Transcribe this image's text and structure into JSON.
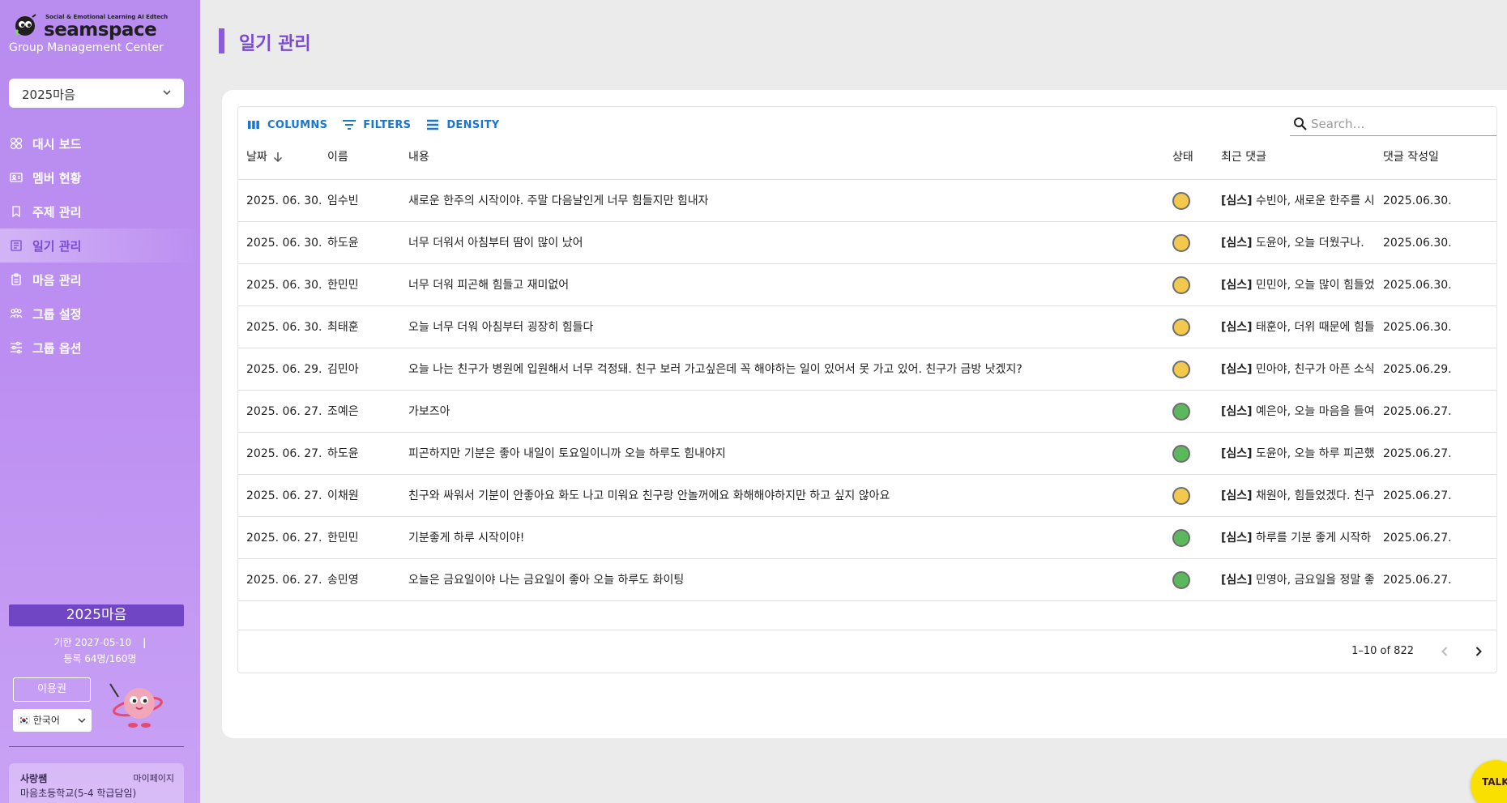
{
  "brand": {
    "tagline": "Social & Emotional Learning AI Edtech",
    "name": "seamspace",
    "subtitle": "Group Management Center"
  },
  "group_select": {
    "value": "2025마음"
  },
  "nav": [
    {
      "label": "대시 보드",
      "icon": "dashboard-icon",
      "active": false
    },
    {
      "label": "멤버 현황",
      "icon": "member-card-icon",
      "active": false
    },
    {
      "label": "주제 관리",
      "icon": "bookmark-icon",
      "active": false
    },
    {
      "label": "일기 관리",
      "icon": "diary-icon",
      "active": true
    },
    {
      "label": "마음 관리",
      "icon": "clipboard-icon",
      "active": false
    },
    {
      "label": "그룹 설정",
      "icon": "group-icon",
      "active": false
    },
    {
      "label": "그룹 옵션",
      "icon": "sliders-icon",
      "active": false
    }
  ],
  "plan": {
    "name": "2025마음",
    "expiry": "기한 2027-05-10",
    "separator": "|",
    "registered": "등록 64명/160명",
    "license_button": "이용권",
    "language": "🇰🇷 한국어"
  },
  "user": {
    "name": "사랑쌤",
    "mypage": "마이페이지",
    "school": "마음초등학교(5-4 학급담임)"
  },
  "page": {
    "title": "일기 관리"
  },
  "toolbar": {
    "columns": "COLUMNS",
    "filters": "FILTERS",
    "density": "DENSITY",
    "search_placeholder": "Search…"
  },
  "table": {
    "headers": {
      "date": "날짜",
      "name": "이름",
      "content": "내용",
      "status": "상태",
      "comment": "최근 댓글",
      "comment_date": "댓글 작성일"
    },
    "rows": [
      {
        "date": "2025. 06. 30.",
        "name": "임수빈",
        "content": "새로운 한주의 시작이야. 주말 다음날인게 너무 힘들지만 힘내자",
        "status": "yellow",
        "comment_tag": "[심스]",
        "comment": " 수빈아, 새로운 한주를 시",
        "comment_date": "2025.06.30."
      },
      {
        "date": "2025. 06. 30.",
        "name": "하도윤",
        "content": "너무 더워서 아침부터 땀이 많이 났어",
        "status": "yellow",
        "comment_tag": "[심스]",
        "comment": " 도윤아, 오늘 더웠구나.",
        "comment_date": "2025.06.30."
      },
      {
        "date": "2025. 06. 30.",
        "name": "한민민",
        "content": "너무 더워 피곤해 힘들고 재미없어",
        "status": "yellow",
        "comment_tag": "[심스]",
        "comment": " 민민아, 오늘 많이 힘들었",
        "comment_date": "2025.06.30."
      },
      {
        "date": "2025. 06. 30.",
        "name": "최태훈",
        "content": "오늘 너무 더워 아침부터 굉장히 힘들다",
        "status": "yellow",
        "comment_tag": "[심스]",
        "comment": " 태훈아, 더위 때문에 힘들",
        "comment_date": "2025.06.30."
      },
      {
        "date": "2025. 06. 29.",
        "name": "김민아",
        "content": "오늘 나는 친구가 병원에 입원해서 너무 걱정돼. 친구 보러 가고싶은데 꼭 해야하는 일이 있어서 못 가고 있어. 친구가 금방 낫겠지?",
        "status": "yellow",
        "comment_tag": "[심스]",
        "comment": " 민아야, 친구가 아픈 소식",
        "comment_date": "2025.06.29."
      },
      {
        "date": "2025. 06. 27.",
        "name": "조예은",
        "content": "가보즈아",
        "status": "green",
        "comment_tag": "[심스]",
        "comment": " 예은아, 오늘 마음을 들여",
        "comment_date": "2025.06.27."
      },
      {
        "date": "2025. 06. 27.",
        "name": "하도윤",
        "content": "피곤하지만 기분은 좋아 내일이 토요일이니까 오늘 하루도 힘내야지",
        "status": "green",
        "comment_tag": "[심스]",
        "comment": " 도윤아, 오늘 하루 피곤했",
        "comment_date": "2025.06.27."
      },
      {
        "date": "2025. 06. 27.",
        "name": "이채원",
        "content": "친구와 싸워서 기분이 안좋아요 화도 나고 미워요 친구랑 안놀꺼에요 화해해야하지만 하고 싶지 않아요",
        "status": "yellow",
        "comment_tag": "[심스]",
        "comment": " 채원아, 힘들었겠다. 친구",
        "comment_date": "2025.06.27."
      },
      {
        "date": "2025. 06. 27.",
        "name": "한민민",
        "content": "기분좋게 하루 시작이야!",
        "status": "green",
        "comment_tag": "[심스]",
        "comment": " 하루를 기분 좋게 시작하",
        "comment_date": "2025.06.27."
      },
      {
        "date": "2025. 06. 27.",
        "name": "송민영",
        "content": "오늘은 금요일이야 나는 금요일이 좋아 오늘 하루도 화이팅",
        "status": "green",
        "comment_tag": "[심스]",
        "comment": " 민영아, 금요일을 정말 좋",
        "comment_date": "2025.06.27."
      }
    ],
    "status_colors": {
      "yellow": "#f2c94c",
      "green": "#5cb85c"
    },
    "pagination": "1–10 of 822"
  },
  "talk_button": "TALK",
  "colors": {
    "accent": "#7a4bd1",
    "link": "#1976d2",
    "sidebar": "#b98cf0"
  }
}
